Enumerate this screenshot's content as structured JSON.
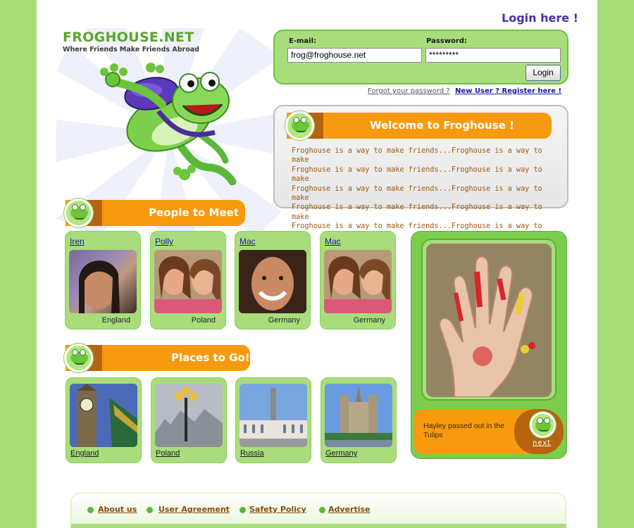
{
  "logo": {
    "title": "FROGHOUSE.NET",
    "tagline": "Where Friends Make Friends Abroad"
  },
  "login": {
    "heading": "Login here !",
    "email_label": "E-mail:",
    "email_value": "frog@froghouse.net",
    "password_label": "Password:",
    "password_value": "*********",
    "button": "Login",
    "forgot": "Forgot your password ?",
    "register": "New User ? Register here !"
  },
  "welcome": {
    "title": "Welcome to Froghouse !",
    "lines": [
      "Froghouse is a way to make friends...Froghouse is a way to make",
      "Froghouse is a way to make friends...Froghouse is a way to make",
      "Froghouse is a way to make friends...Froghouse is a way to make",
      "Froghouse is a way to make friends...Froghouse is a way to make",
      "Froghouse is a way to make friends...Froghouse is a way to make"
    ]
  },
  "people": {
    "title": "People to Meet !",
    "cards": [
      {
        "name": "Iren",
        "country": "England"
      },
      {
        "name": "Polly",
        "country": "Poland"
      },
      {
        "name": "Mac",
        "country": "Germany"
      },
      {
        "name": "Mac",
        "country": "Germany"
      }
    ]
  },
  "places": {
    "title": "Places to Go!",
    "cards": [
      {
        "name": "England"
      },
      {
        "name": "Poland"
      },
      {
        "name": "Russia"
      },
      {
        "name": "Germany"
      }
    ]
  },
  "featured": {
    "caption": "Hayley passed out in the Tulips",
    "next": "next"
  },
  "footer": {
    "links": [
      "About us",
      "User Agreement",
      "Safety Policy",
      "Advertise"
    ]
  },
  "colors": {
    "side_green": "#a8dc78",
    "box_green": "#a9dd7c",
    "orange": "#f79a0e",
    "dark_orange": "#b56410",
    "link_blue": "#1a1aa0"
  }
}
